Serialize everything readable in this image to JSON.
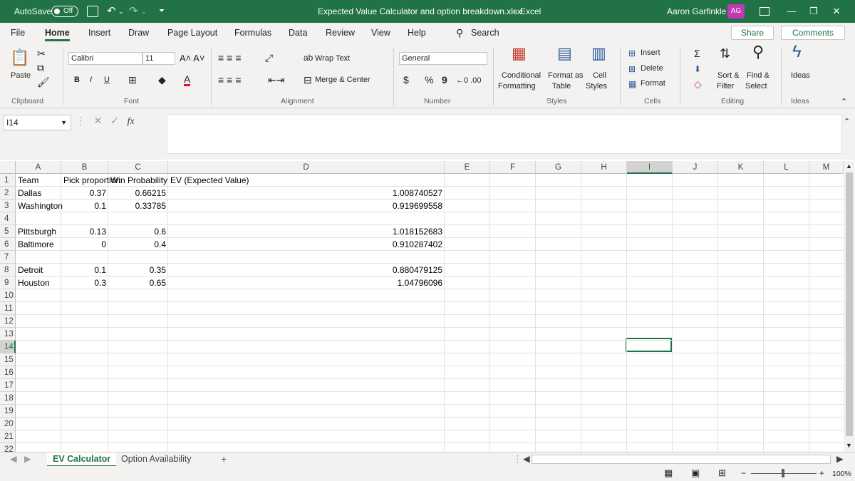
{
  "titlebar": {
    "autosave_label": "AutoSave",
    "autosave_state": "Off",
    "file_title": "Expected Value Calculator and option breakdown.xlsx",
    "separator": "-",
    "app_name": "Excel",
    "user_name": "Aaron Garfinkle",
    "user_initials": "AG",
    "accent_color": "#217346"
  },
  "menu": {
    "tabs": [
      "File",
      "Home",
      "Insert",
      "Draw",
      "Page Layout",
      "Formulas",
      "Data",
      "Review",
      "View",
      "Help"
    ],
    "active_tab": "Home",
    "search_label": "Search",
    "share_label": "Share",
    "comments_label": "Comments"
  },
  "ribbon": {
    "clipboard": {
      "paste": "Paste",
      "group": "Clipboard"
    },
    "font": {
      "name": "Calibri",
      "size": "11",
      "bold": "B",
      "italic": "I",
      "underline": "U",
      "group": "Font"
    },
    "alignment": {
      "wrap_text": "Wrap Text",
      "merge_center": "Merge & Center",
      "group": "Alignment"
    },
    "number": {
      "format": "General",
      "currency": "$",
      "percent": "%",
      "comma": "9",
      "group": "Number"
    },
    "styles": {
      "conditional_1": "Conditional",
      "conditional_2": "Formatting",
      "format_table_1": "Format as",
      "format_table_2": "Table",
      "cell_styles_1": "Cell",
      "cell_styles_2": "Styles",
      "group": "Styles"
    },
    "cells": {
      "insert": "Insert",
      "delete": "Delete",
      "format": "Format",
      "group": "Cells"
    },
    "editing": {
      "sort_1": "Sort &",
      "sort_2": "Filter",
      "find_1": "Find &",
      "find_2": "Select",
      "group": "Editing"
    },
    "ideas": {
      "label": "Ideas",
      "group": "Ideas"
    }
  },
  "formula_bar": {
    "name_box": "I14",
    "fx": "fx",
    "content": ""
  },
  "grid": {
    "columns": [
      "A",
      "B",
      "C",
      "D",
      "E",
      "F",
      "G",
      "H",
      "I",
      "J",
      "K",
      "L",
      "M"
    ],
    "selected_column": "I",
    "selected_row": "14",
    "rows": [
      "1",
      "2",
      "3",
      "4",
      "5",
      "6",
      "7",
      "8",
      "9",
      "10",
      "11",
      "12",
      "13",
      "14",
      "15",
      "16",
      "17",
      "18",
      "19",
      "20",
      "21",
      "22"
    ],
    "cells": {
      "A1": "Team",
      "B1": "Pick proportion",
      "C1": "Win Probability",
      "D1": "EV (Expected Value)",
      "A2": "Dallas",
      "B2": "0.37",
      "C2": "0.66215",
      "D2": "1.008740527",
      "A3": "Washington",
      "B3": "0.1",
      "C3": "0.33785",
      "D3": "0.919699558",
      "A5": "Pittsburgh",
      "B5": "0.13",
      "C5": "0.6",
      "D5": "1.018152683",
      "A6": "Baltimore",
      "B6": "0",
      "C6": "0.4",
      "D6": "0.910287402",
      "A8": "Detroit",
      "B8": "0.1",
      "C8": "0.35",
      "D8": "0.880479125",
      "A9": "Houston",
      "B9": "0.3",
      "C9": "0.65",
      "D9": "1.04796096"
    }
  },
  "sheets": {
    "tabs": [
      "EV Calculator",
      "Option Availability"
    ],
    "active": "EV Calculator",
    "add": "+"
  },
  "status": {
    "zoom": "100%"
  }
}
